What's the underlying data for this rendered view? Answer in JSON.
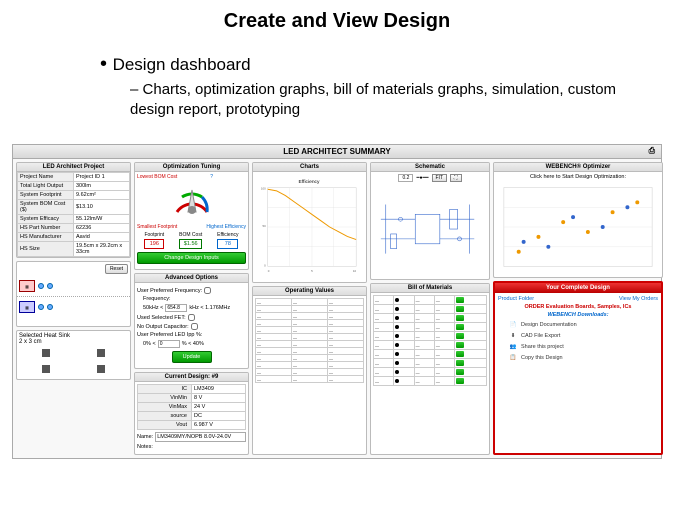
{
  "slide": {
    "title": "Create and View Design",
    "bullet_main": "Design dashboard",
    "bullet_sub": "Charts, optimization graphs, bill of materials graphs, simulation, custom design report, prototyping"
  },
  "dashboard": {
    "title": "LED ARCHITECT SUMMARY"
  },
  "project": {
    "header": "LED Architect Project",
    "rows": [
      {
        "k": "Project Name",
        "v": "Project ID 1"
      },
      {
        "k": "Total Light Output",
        "v": "300lm"
      },
      {
        "k": "System Footprint",
        "v": "9.62cm²"
      },
      {
        "k": "System BOM Cost ($)",
        "v": "$13.10"
      },
      {
        "k": "System Efficacy",
        "v": "55.12lm/W"
      },
      {
        "k": "HS Part Number",
        "v": "62236"
      },
      {
        "k": "HS Manufacturer",
        "v": "Aavid"
      },
      {
        "k": "HS Size",
        "v": "19.5cm x 29.2cm x 33cm"
      }
    ],
    "reset": "Reset"
  },
  "heatsink": {
    "title": "Selected Heat Sink",
    "dims": "2 x 3 cm"
  },
  "optimization": {
    "header": "Optimization Tuning",
    "lowest": "Lowest BOM Cost",
    "smallest": "Smallest Footprint",
    "highest": "Highest Efficiency",
    "metrics": [
      {
        "label": "Footprint",
        "value": "196",
        "cls": "r"
      },
      {
        "label": "BOM Cost",
        "value": "$1.56",
        "cls": "g"
      },
      {
        "label": "Efficiency",
        "value": "78",
        "cls": "b"
      }
    ],
    "change_btn": "Change Design Inputs"
  },
  "advanced": {
    "header": "Advanced Options",
    "freq_label": "User Preferred Frequency:",
    "freq_sub": "Frequency:",
    "freq_low": "50kHz <",
    "freq_val": "654.8",
    "freq_hi": "kHz < 1.176MHz",
    "fet": "Used Selected FET:",
    "nocap": "No Output Capacitor:",
    "ipp": "User Preferred LED Ipp %:",
    "ipp_low": "0% <",
    "ipp_val": "0",
    "ipp_hi": "% < 40%",
    "update": "Update"
  },
  "current_design": {
    "header": "Current Design: #9",
    "rows": [
      {
        "k": "IC",
        "v": "LM3409"
      },
      {
        "k": "VinMin",
        "v": "8 V"
      },
      {
        "k": "VinMax",
        "v": "24 V"
      },
      {
        "k": "source",
        "v": "DC"
      },
      {
        "k": "Vout",
        "v": "6.987 V"
      }
    ],
    "name_label": "Name:",
    "name_value": "LM3409MY/NOPB 8.0V-24.0V",
    "notes_label": "Notes:"
  },
  "charts": {
    "header": "Charts",
    "sub": "Efficiency"
  },
  "operating": {
    "header": "Operating Values"
  },
  "bom": {
    "header": "Bill of Materials"
  },
  "schematic": {
    "header": "Schematic",
    "value": "0.2",
    "fit": "FIT"
  },
  "optimizer": {
    "header": "WEBENCH® Optimizer",
    "link": "Click here to Start Design Optimization:"
  },
  "your_design": {
    "header": "Your Complete Design",
    "pf": "Product Folder",
    "vo": "View My Orders",
    "order": "ORDER Evaluation Boards, Samples, ICs",
    "downloads": "WEBENCH Downloads:",
    "doc": "Design Documentation",
    "cad": "CAD File Export",
    "share": "Share this project",
    "copy": "Copy this Design"
  },
  "chart_data": {
    "type": "line",
    "title": "Efficiency",
    "xlabel": "",
    "ylabel": "",
    "xlim": [
      0,
      10
    ],
    "ylim": [
      0,
      100
    ],
    "series": [
      {
        "name": "Efficiency",
        "x": [
          0,
          1,
          2,
          3,
          4,
          5,
          6,
          7,
          8,
          9,
          10
        ],
        "values": [
          98,
          96,
          90,
          82,
          74,
          66,
          58,
          50,
          44,
          38,
          34
        ]
      }
    ]
  }
}
